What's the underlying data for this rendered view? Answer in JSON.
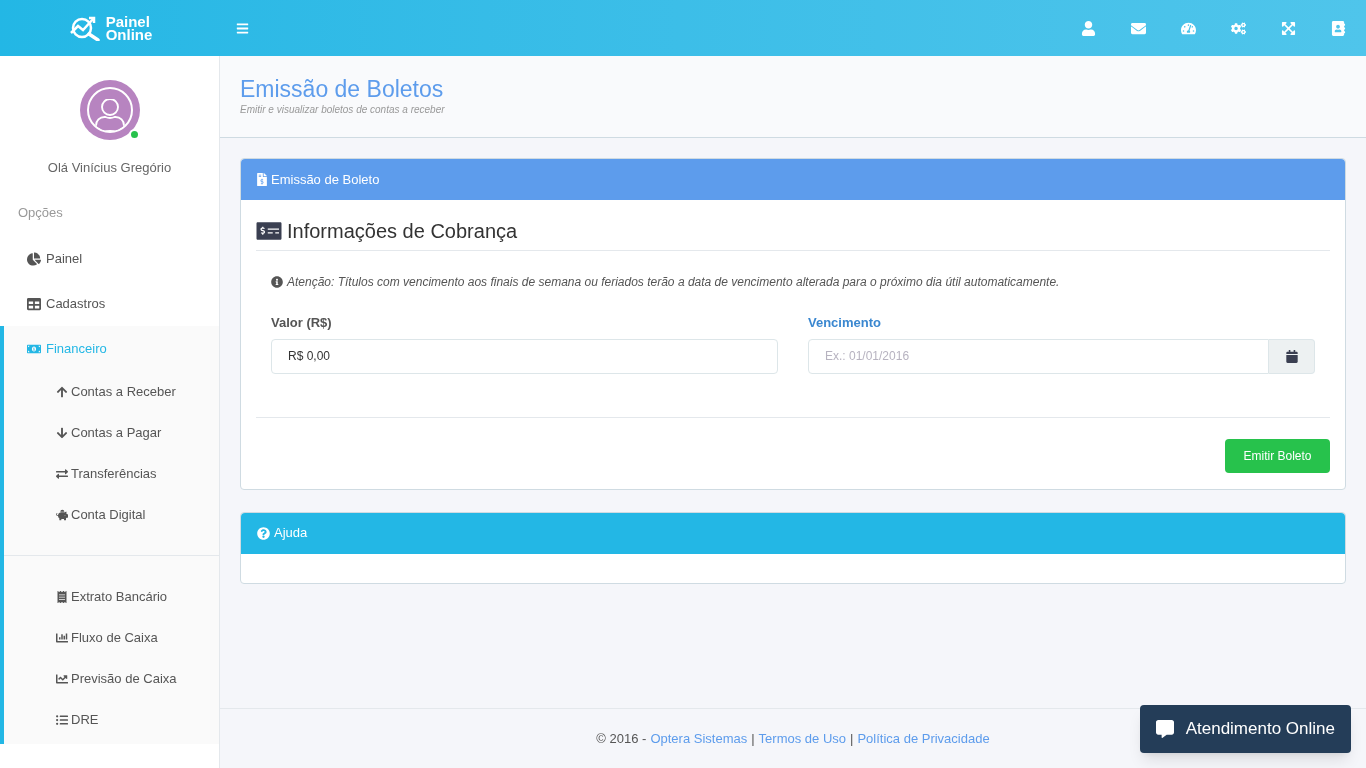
{
  "header": {
    "logo_line1": "Painel",
    "logo_line2": "Online"
  },
  "sidebar": {
    "greeting": "Olá Vinícius Gregório",
    "online": true,
    "section_title": "Opções",
    "items": [
      {
        "label": "Painel",
        "selected": false,
        "expanded": false
      },
      {
        "label": "Cadastros",
        "selected": false,
        "expanded": false
      },
      {
        "label": "Financeiro",
        "selected": true,
        "expanded": true,
        "children": [
          {
            "kind": "link",
            "label": "Contas a Receber"
          },
          {
            "kind": "link",
            "label": "Contas a Pagar"
          },
          {
            "kind": "link",
            "label": "Transferências"
          },
          {
            "kind": "link",
            "label": "Conta Digital"
          },
          {
            "kind": "divider"
          },
          {
            "kind": "link",
            "label": "Extrato Bancário"
          },
          {
            "kind": "link",
            "label": "Fluxo de Caixa"
          },
          {
            "kind": "link",
            "label": "Previsão de Caixa"
          },
          {
            "kind": "link",
            "label": "DRE"
          }
        ]
      }
    ]
  },
  "page": {
    "title": "Emissão de Boletos",
    "subtitle": "Emitir e visualizar boletos de contas a receber"
  },
  "form_panel": {
    "title": "Emissão de Boleto",
    "section_title": "Informações de Cobrança",
    "notice": "Atenção: Títulos com vencimento aos finais de semana ou feriados terão a data de vencimento alterada para o próximo dia útil automaticamente.",
    "fields": [
      {
        "kind": "text",
        "label": "Valor (R$)",
        "value": "R$ 0,00",
        "focused": false
      },
      {
        "kind": "date",
        "label": "Vencimento",
        "placeholder": "Ex.: 01/01/2016",
        "focused": true
      }
    ],
    "submit": "Emitir Boleto"
  },
  "help_panel": {
    "title": "Ajuda"
  },
  "footer": [
    {
      "kind": "text",
      "text": "© 2016 -"
    },
    {
      "kind": "link",
      "text": "Optera Sistemas"
    },
    {
      "kind": "text",
      "text": "|"
    },
    {
      "kind": "link",
      "text": "Termos de Uso"
    },
    {
      "kind": "text",
      "text": "|"
    },
    {
      "kind": "link",
      "text": "Política de Privacidade"
    }
  ],
  "chat_button": "Atendimento Online"
}
